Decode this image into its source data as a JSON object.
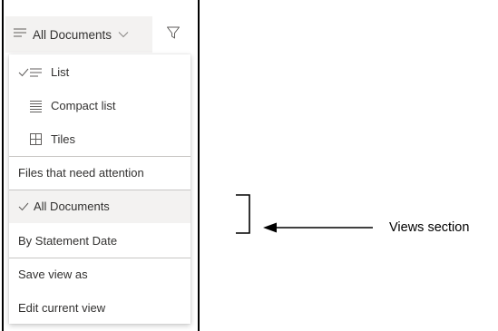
{
  "command_bar": {
    "view_button_label": "All Documents",
    "view_icon": "lines-icon",
    "chevron_icon": "chevron-down-icon",
    "filter_icon": "filter-icon"
  },
  "menu": {
    "layout_items": [
      {
        "label": "List",
        "icon": "list-icon",
        "checked": true
      },
      {
        "label": "Compact list",
        "icon": "compact-list-icon",
        "checked": false
      },
      {
        "label": "Tiles",
        "icon": "tiles-icon",
        "checked": false
      }
    ],
    "attention_item": "Files that need attention",
    "view_items": [
      {
        "label": "All Documents",
        "checked": true,
        "selected": true
      },
      {
        "label": "By Statement Date",
        "checked": false,
        "selected": false
      }
    ],
    "action_items": [
      {
        "label": "Save view as"
      },
      {
        "label": "Edit current view"
      }
    ]
  },
  "annotation": {
    "text": "Views section"
  },
  "colors": {
    "selected_bg": "#f3f2f1",
    "text": "#323130",
    "divider": "#c8c6c4"
  }
}
